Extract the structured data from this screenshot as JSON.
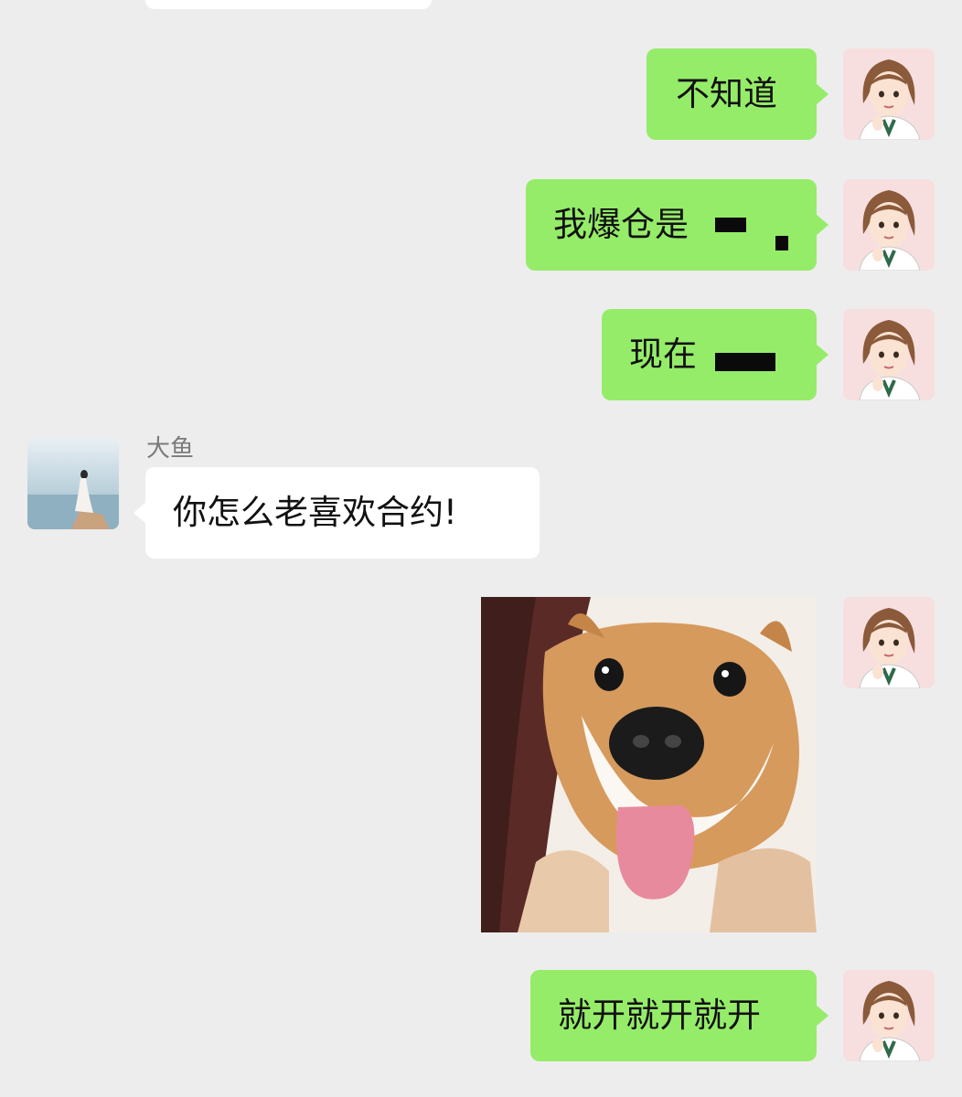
{
  "chat": {
    "messages": [
      {
        "id": "m1",
        "side": "right",
        "text": "不知道"
      },
      {
        "id": "m2",
        "side": "right",
        "text": "我爆仓是"
      },
      {
        "id": "m3",
        "side": "right",
        "text": "现在"
      },
      {
        "id": "m4",
        "side": "left",
        "sender": "大鱼",
        "text": "你怎么老喜欢合约!"
      },
      {
        "id": "m5",
        "side": "right",
        "type": "image",
        "icon": "shiba-dog-photo"
      },
      {
        "id": "m6",
        "side": "right",
        "text": "就开就开就开"
      }
    ]
  },
  "colors": {
    "background": "#ededed",
    "outgoing_bubble": "#95ec69",
    "incoming_bubble": "#ffffff",
    "sender_name": "#7a7a7a"
  },
  "icons": {
    "self_avatar": "cartoon-girl-avatar",
    "other_avatar": "beach-woman-avatar"
  }
}
